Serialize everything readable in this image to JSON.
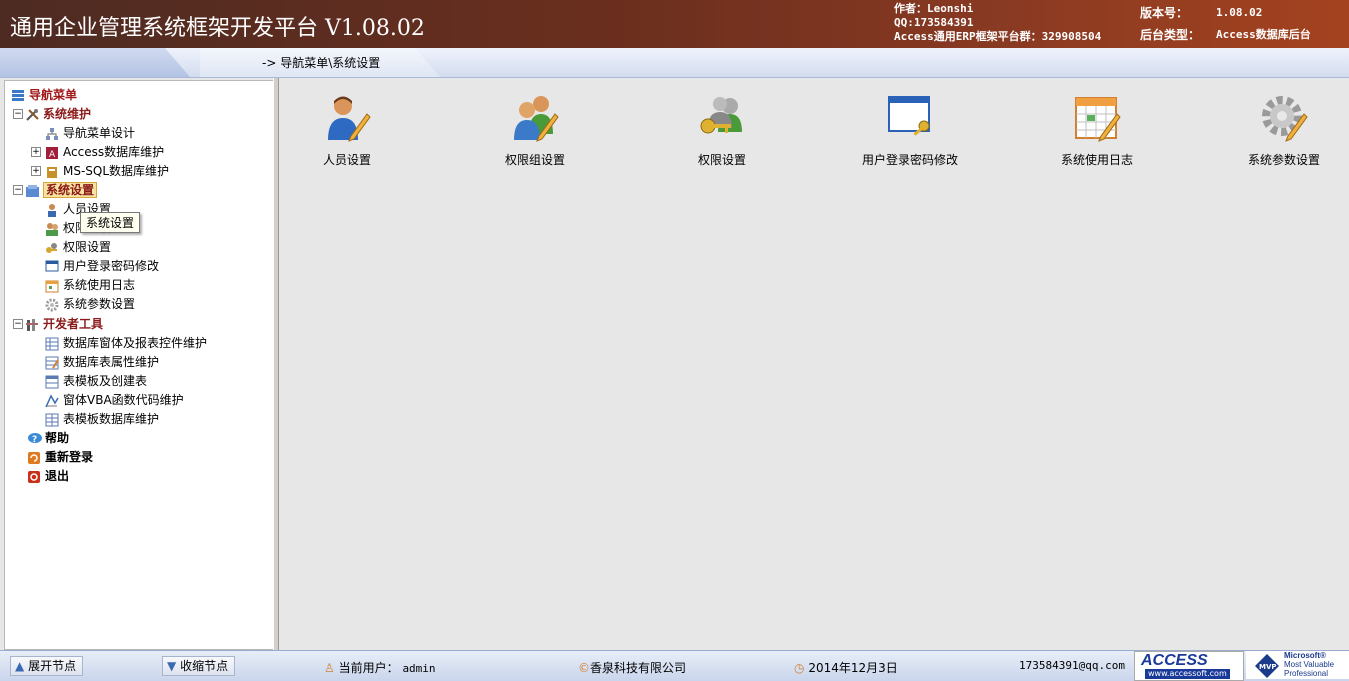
{
  "header": {
    "title": "通用企业管理系统框架开发平台 V1.08.02",
    "author": "作者：Leonshi",
    "qq": "QQ:173584391",
    "group": "Access通用ERP框架平台群：329908504",
    "version_label": "版本号：",
    "version_value": "1.08.02",
    "backend_label": "后台类型：",
    "backend_value": "Access数据库后台"
  },
  "breadcrumb": "-> 导航菜单\\系统设置",
  "tree": {
    "root": "导航菜单",
    "system_maintenance": {
      "label": "系统维护",
      "items": [
        "导航菜单设计",
        "Access数据库维护",
        "MS-SQL数据库维护"
      ]
    },
    "system_settings": {
      "label": "系统设置",
      "items": [
        "人员设置",
        "权限组设置",
        "权限设置",
        "用户登录密码修改",
        "系统使用日志",
        "系统参数设置"
      ]
    },
    "developer_tools": {
      "label": "开发者工具",
      "items": [
        "数据库窗体及报表控件维护",
        "数据库表属性维护",
        "表模板及创建表",
        "窗体VBA函数代码维护",
        "表模板数据库维护"
      ]
    },
    "help": "帮助",
    "relogin": "重新登录",
    "exit": "退出",
    "tooltip": "系统设置"
  },
  "tiles": [
    {
      "label": "人员设置",
      "icon": "person-edit-icon"
    },
    {
      "label": "权限组设置",
      "icon": "group-edit-icon"
    },
    {
      "label": "权限设置",
      "icon": "users-key-icon"
    },
    {
      "label": "用户登录密码修改",
      "icon": "window-key-icon"
    },
    {
      "label": "系统使用日志",
      "icon": "calendar-edit-icon"
    },
    {
      "label": "系统参数设置",
      "icon": "gear-edit-icon"
    }
  ],
  "footer": {
    "expand": "展开节点",
    "collapse": "收缩节点",
    "current_user_label": "当前用户：",
    "current_user": "admin",
    "company": "香泉科技有限公司",
    "date": "2014年12月3日",
    "email": "173584391@qq.com",
    "access_logo": "ACCESS",
    "access_url": "www.accessoft.com",
    "mvp_line1": "Microsoft®",
    "mvp_line2": "Most Valuable",
    "mvp_line3": "Professional"
  },
  "colors": {
    "header_bg": "#6a2e1e",
    "group_text": "#8b1a1a",
    "selection": "#f9e3a0"
  }
}
